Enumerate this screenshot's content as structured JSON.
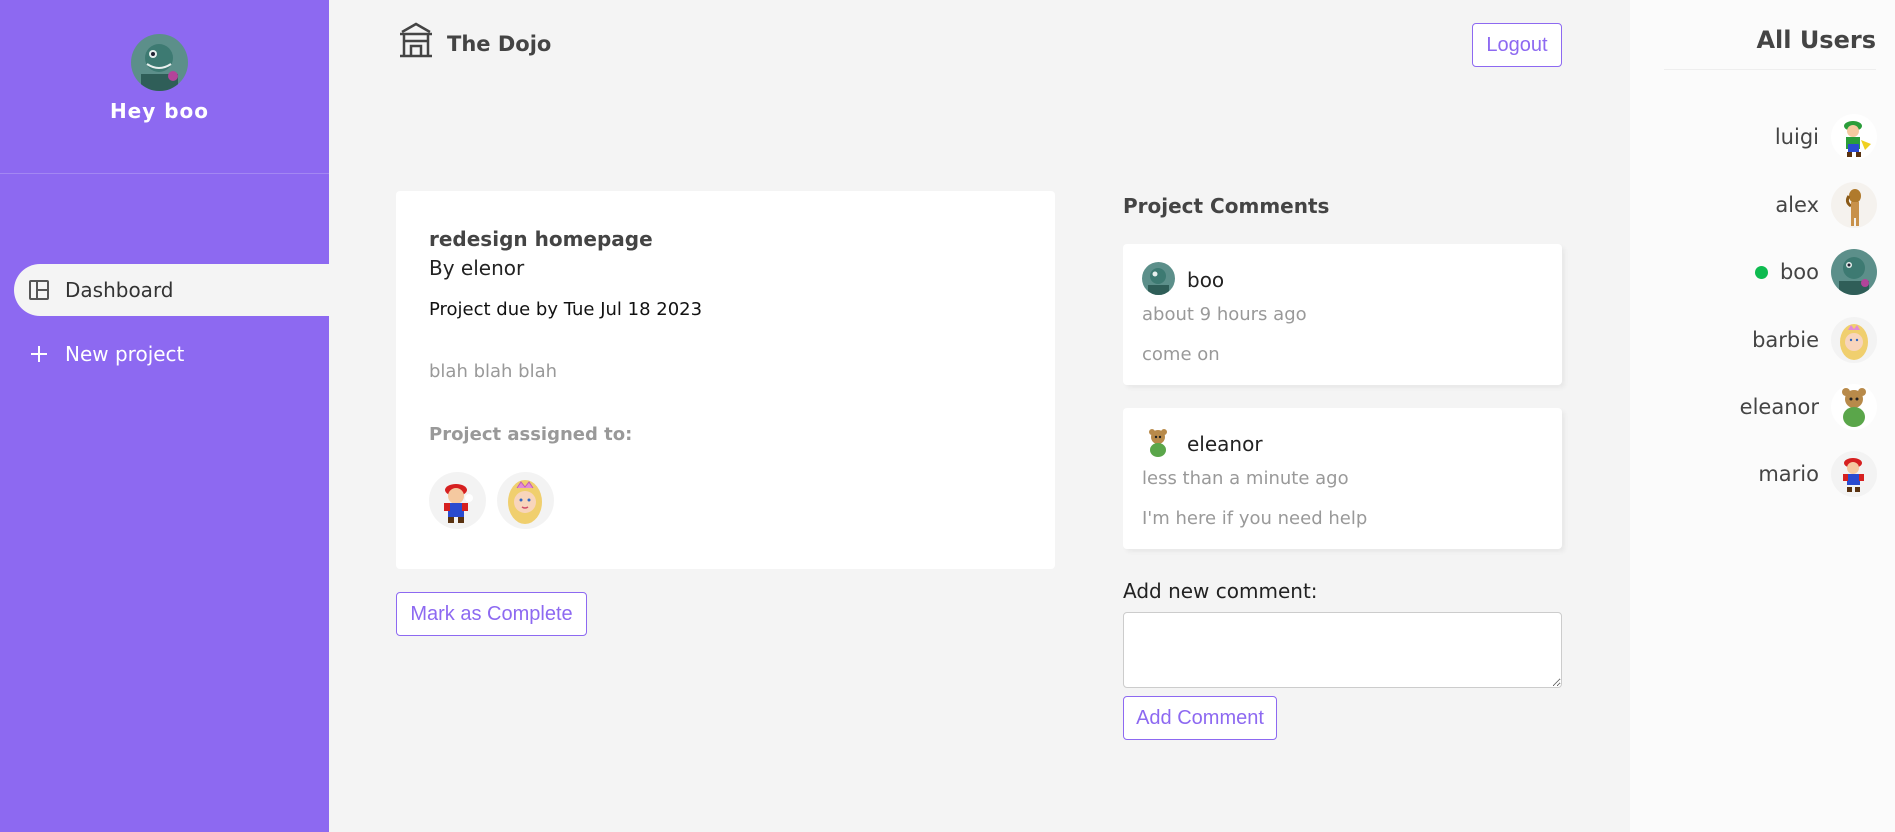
{
  "sidebar": {
    "greeting": "Hey boo",
    "nav": [
      {
        "label": "Dashboard",
        "active": true,
        "icon": "dashboard-icon"
      },
      {
        "label": "New project",
        "active": false,
        "icon": "plus-icon"
      }
    ]
  },
  "topbar": {
    "brand": "The Dojo",
    "logo_icon": "temple-icon",
    "logout_label": "Logout"
  },
  "project": {
    "name": "redesign homepage",
    "author": "By elenor",
    "due": "Project due by Tue Jul 18 2023",
    "details": "blah blah blah",
    "assigned_label": "Project assigned to:",
    "assignees": [
      "mario",
      "barbie"
    ],
    "mark_complete_label": "Mark as Complete"
  },
  "comments": {
    "title": "Project Comments",
    "items": [
      {
        "name": "boo",
        "date": "about 9 hours ago",
        "text": "come on"
      },
      {
        "name": "eleanor",
        "date": "less than a minute ago",
        "text": "I'm here if you need help"
      }
    ],
    "new_label": "Add new comment:",
    "textarea_value": "",
    "add_label": "Add Comment"
  },
  "users": {
    "title": "All Users",
    "list": [
      {
        "name": "luigi",
        "online": false
      },
      {
        "name": "alex",
        "online": false
      },
      {
        "name": "boo",
        "online": true
      },
      {
        "name": "barbie",
        "online": false
      },
      {
        "name": "eleanor",
        "online": false
      },
      {
        "name": "mario",
        "online": false
      }
    ]
  },
  "colors": {
    "primary": "#8d69f1",
    "background": "#f4f4f4",
    "online": "#0ebb50"
  }
}
